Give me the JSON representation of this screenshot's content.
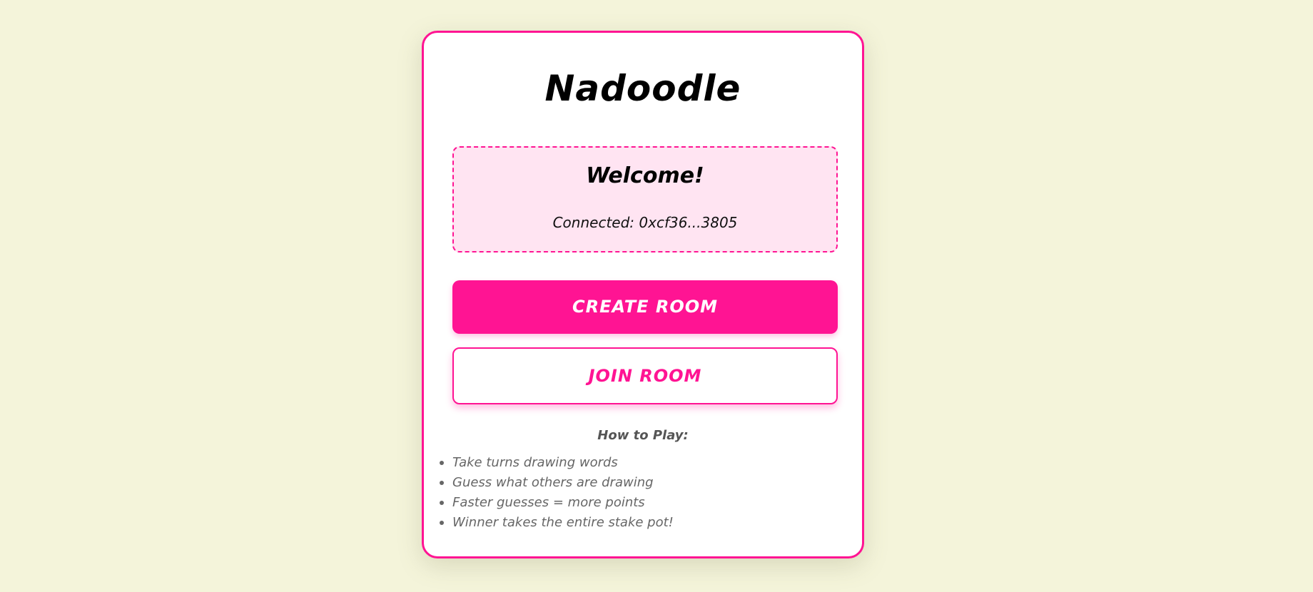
{
  "app": {
    "title": "Nadoodle"
  },
  "welcome": {
    "heading": "Welcome!",
    "connected_label": "Connected: 0xcf36...3805"
  },
  "actions": {
    "create_room_label": "CREATE ROOM",
    "join_room_label": "JOIN ROOM"
  },
  "how_to_play": {
    "title": "How to Play:",
    "items": [
      "Take turns drawing words",
      "Guess what others are drawing",
      "Faster guesses = more points",
      "Winner takes the entire stake pot!"
    ]
  },
  "colors": {
    "background": "#f4f4da",
    "accent": "#ff1493",
    "welcome_box": "#ffe4f2",
    "card": "#ffffff"
  }
}
